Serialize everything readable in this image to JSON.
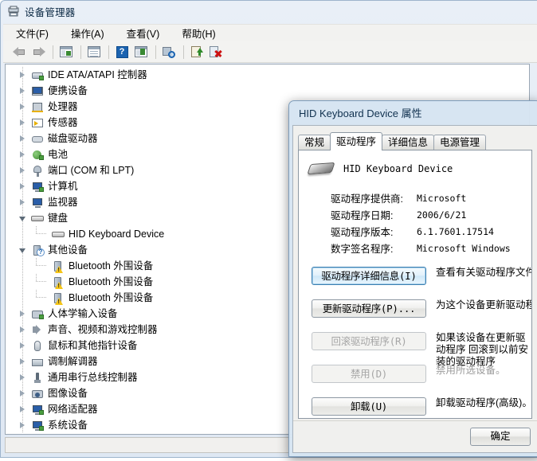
{
  "window": {
    "title": "设备管理器",
    "icon": "device-manager-icon"
  },
  "menu": [
    {
      "label": "文件(F)",
      "name": "menu-file"
    },
    {
      "label": "操作(A)",
      "name": "menu-action"
    },
    {
      "label": "查看(V)",
      "name": "menu-view"
    },
    {
      "label": "帮助(H)",
      "name": "menu-help"
    }
  ],
  "toolbar": [
    {
      "name": "back-button",
      "icon": "arrow-left-icon"
    },
    {
      "name": "forward-button",
      "icon": "arrow-right-icon"
    },
    {
      "name": "show-hide-console-tree-button",
      "icon": "console-tree-icon"
    },
    {
      "name": "properties-button",
      "icon": "properties-window-icon"
    },
    {
      "name": "help-button",
      "icon": "help-question-icon"
    },
    {
      "name": "show-hide-action-pane-button",
      "icon": "action-pane-icon"
    },
    {
      "name": "scan-hardware-changes-button",
      "icon": "scan-magnifier-icon"
    },
    {
      "name": "update-driver-button",
      "icon": "update-driver-icon"
    },
    {
      "name": "uninstall-device-button",
      "icon": "uninstall-device-icon"
    }
  ],
  "tree": {
    "items": [
      {
        "label": "IDE ATA/ATAPI 控制器",
        "icon": "ide-controller-icon",
        "level": 1,
        "state": "collapsed"
      },
      {
        "label": "便携设备",
        "icon": "portable-device-icon",
        "level": 1,
        "state": "collapsed"
      },
      {
        "label": "处理器",
        "icon": "processor-icon",
        "level": 1,
        "state": "collapsed"
      },
      {
        "label": "传感器",
        "icon": "sensor-icon",
        "level": 1,
        "state": "collapsed"
      },
      {
        "label": "磁盘驱动器",
        "icon": "disk-drive-icon",
        "level": 1,
        "state": "collapsed"
      },
      {
        "label": "电池",
        "icon": "battery-icon",
        "level": 1,
        "state": "collapsed"
      },
      {
        "label": "端口 (COM 和 LPT)",
        "icon": "port-icon",
        "level": 1,
        "state": "collapsed"
      },
      {
        "label": "计算机",
        "icon": "computer-icon",
        "level": 1,
        "state": "collapsed"
      },
      {
        "label": "监视器",
        "icon": "monitor-icon",
        "level": 1,
        "state": "collapsed"
      },
      {
        "label": "键盘",
        "icon": "keyboard-icon",
        "level": 1,
        "state": "expanded"
      },
      {
        "label": "HID Keyboard Device",
        "icon": "keyboard-icon",
        "level": 2,
        "state": "leaf"
      },
      {
        "label": "其他设备",
        "icon": "unknown-device-icon",
        "level": 1,
        "state": "expanded"
      },
      {
        "label": "Bluetooth 外围设备",
        "icon": "warning-device-icon",
        "level": 2,
        "state": "leaf"
      },
      {
        "label": "Bluetooth 外围设备",
        "icon": "warning-device-icon",
        "level": 2,
        "state": "leaf"
      },
      {
        "label": "Bluetooth 外围设备",
        "icon": "warning-device-icon",
        "level": 2,
        "state": "leaf"
      },
      {
        "label": "人体学输入设备",
        "icon": "hid-icon",
        "level": 1,
        "state": "collapsed"
      },
      {
        "label": "声音、视频和游戏控制器",
        "icon": "sound-icon",
        "level": 1,
        "state": "collapsed"
      },
      {
        "label": "鼠标和其他指针设备",
        "icon": "mouse-icon",
        "level": 1,
        "state": "collapsed"
      },
      {
        "label": "调制解调器",
        "icon": "modem-icon",
        "level": 1,
        "state": "collapsed"
      },
      {
        "label": "通用串行总线控制器",
        "icon": "usb-icon",
        "level": 1,
        "state": "collapsed"
      },
      {
        "label": "图像设备",
        "icon": "imaging-device-icon",
        "level": 1,
        "state": "collapsed"
      },
      {
        "label": "网络适配器",
        "icon": "network-adapter-icon",
        "level": 1,
        "state": "collapsed"
      },
      {
        "label": "系统设备",
        "icon": "system-device-icon",
        "level": 1,
        "state": "collapsed"
      }
    ]
  },
  "status_bar": {
    "text": ""
  },
  "dialog": {
    "title": "HID Keyboard Device 属性",
    "tabs": [
      {
        "label": "常规",
        "active": false
      },
      {
        "label": "驱动程序",
        "active": true
      },
      {
        "label": "详细信息",
        "active": false
      },
      {
        "label": "电源管理",
        "active": false
      }
    ],
    "device_name": "HID Keyboard Device",
    "device_icon": "keyboard-icon",
    "info": [
      {
        "key": "驱动程序提供商:",
        "value": "Microsoft"
      },
      {
        "key": "驱动程序日期:",
        "value": "2006/6/21"
      },
      {
        "key": "驱动程序版本:",
        "value": "6.1.7601.17514"
      },
      {
        "key": "数字签名程序:",
        "value": "Microsoft Windows"
      }
    ],
    "buttons": [
      {
        "label": "驱动程序详细信息(I)",
        "name": "driver-details-button",
        "state": "focused",
        "description": "查看有关驱动程序文件的详",
        "description_state": "enabled",
        "two_line": false
      },
      {
        "label": "更新驱动程序(P)...",
        "name": "update-driver-button",
        "state": "enabled",
        "description": "为这个设备更新驱动程序转",
        "description_state": "enabled",
        "two_line": false
      },
      {
        "label": "回滚驱动程序(R)",
        "name": "roll-back-driver-button",
        "state": "disabled",
        "description": "如果该设备在更新驱动程序\n回滚到以前安装的驱动程序",
        "description_state": "enabled",
        "two_line": true
      },
      {
        "label": "禁用(D)",
        "name": "disable-device-button",
        "state": "disabled",
        "description": "禁用所选设备。",
        "description_state": "disabled",
        "two_line": false
      },
      {
        "label": "卸载(U)",
        "name": "uninstall-driver-button",
        "state": "enabled",
        "description": "卸载驱动程序(高级)。",
        "description_state": "enabled",
        "two_line": false
      }
    ],
    "footer": {
      "ok_label": "确定"
    }
  }
}
